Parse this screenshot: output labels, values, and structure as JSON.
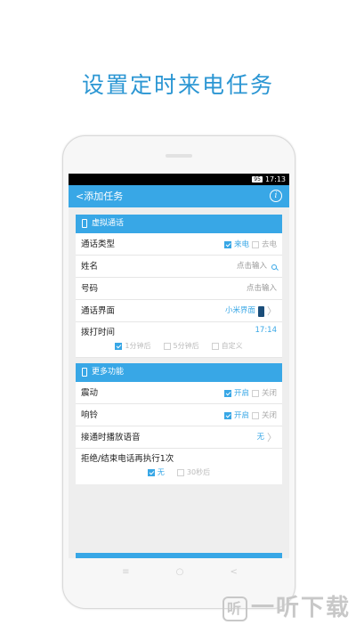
{
  "headline": "设置定时来电任务",
  "status_bar": {
    "battery": "95",
    "time": "17:13"
  },
  "appbar": {
    "back_label": "<添加任务",
    "info_icon": "i"
  },
  "section1": {
    "title": "虚拟通话",
    "call_type": {
      "label": "通话类型",
      "opt1": "来电",
      "opt2": "去电"
    },
    "name": {
      "label": "姓名",
      "placeholder": "点击输入"
    },
    "number": {
      "label": "号码",
      "placeholder": "点击输入"
    },
    "call_ui": {
      "label": "通话界面",
      "value": "小米界面",
      "chevron": "〉"
    },
    "dial_time": {
      "label": "拨打时间",
      "value": "17:14",
      "opt1": "1分钟后",
      "opt2": "5分钟后",
      "opt3": "自定义"
    }
  },
  "section2": {
    "title": "更多功能",
    "vibrate": {
      "label": "震动",
      "on": "开启",
      "off": "关闭"
    },
    "ring": {
      "label": "响铃",
      "on": "开启",
      "off": "关闭"
    },
    "voice": {
      "label": "接通时播放语音",
      "value": "无",
      "chevron": "〉"
    },
    "repeat": {
      "label": "拒绝/结束电话再执行1次",
      "opt1": "无",
      "opt2": "30秒后"
    }
  },
  "nav": {
    "menu": "≡",
    "home": "○",
    "back": "<"
  },
  "watermark": {
    "logo": "听",
    "text": "一听下载"
  },
  "colors": {
    "accent": "#38a7e6",
    "headline": "#2b96d3"
  }
}
